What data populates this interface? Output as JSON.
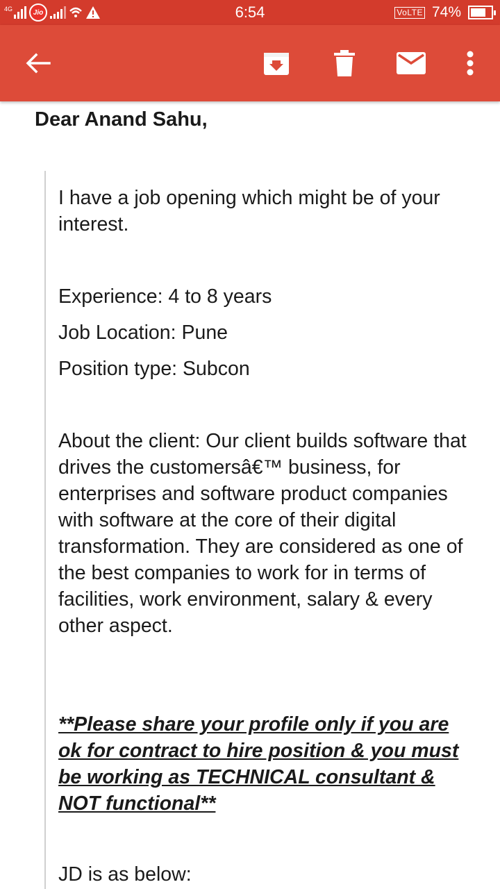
{
  "status_bar": {
    "network_label": "4G",
    "carrier_badge": "Jio",
    "time": "6:54",
    "volte": "VoLTE",
    "battery_percent": "74%",
    "battery_level": 0.74,
    "colors": {
      "background": "#d33b2c"
    }
  },
  "toolbar": {
    "back_icon": "arrow-left-icon",
    "archive_icon": "archive-icon",
    "delete_icon": "trash-icon",
    "mail_icon": "mail-icon",
    "more_icon": "more-vertical-icon",
    "colors": {
      "background": "#dd4b39",
      "icon": "#ffffff"
    }
  },
  "email": {
    "greeting": "Dear Anand Sahu,",
    "intro": "I have a job opening which might be of your interest.",
    "experience": "Experience: 4 to 8 years",
    "location": "Job Location: Pune",
    "position_type": "Position type: Subcon",
    "about": "About the client: Our client builds software that drives the customersâ€™ business, for enterprises and software product companies with software at the core of their digital transformation. They are considered as one of the best companies to work for in terms of facilities, work environment, salary & every other aspect.",
    "note": "**Please share your profile only if you are ok for contract to hire position & you must be working as TECHNICAL consultant & NOT functional**",
    "jd_heading": "JD is as below:"
  }
}
